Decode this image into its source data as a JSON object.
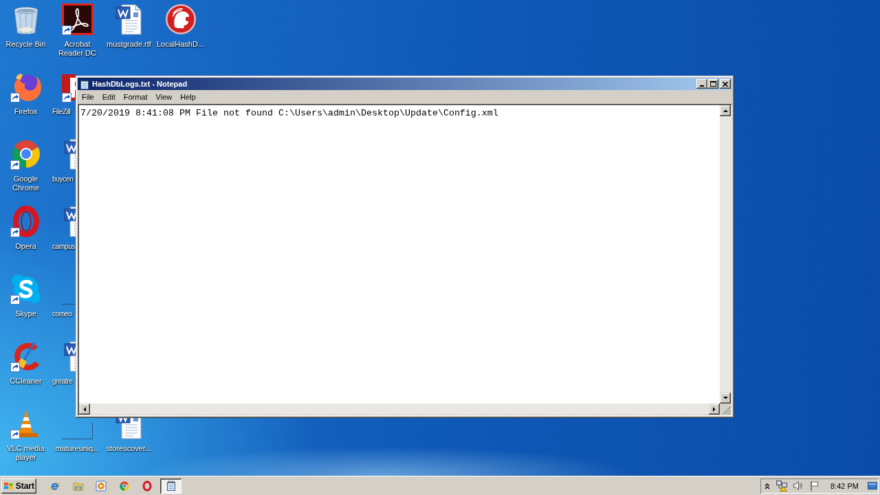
{
  "desktop": {
    "columns": [
      {
        "icons": [
          {
            "label": "Recycle Bin",
            "kind": "recyclebin",
            "shortcut": false,
            "partly_hidden": false,
            "top_hidden": false
          },
          {
            "label": "Firefox",
            "kind": "firefox",
            "shortcut": true,
            "partly_hidden": false,
            "top_hidden": false
          },
          {
            "label": "Google Chrome",
            "kind": "chrome",
            "shortcut": true,
            "partly_hidden": false,
            "top_hidden": false
          },
          {
            "label": "Opera",
            "kind": "opera",
            "shortcut": true,
            "partly_hidden": false,
            "top_hidden": false
          },
          {
            "label": "Skype",
            "kind": "skype",
            "shortcut": true,
            "partly_hidden": false,
            "top_hidden": false
          },
          {
            "label": "CCleaner",
            "kind": "ccleaner",
            "shortcut": true,
            "partly_hidden": false,
            "top_hidden": false
          },
          {
            "label": "VLC media player",
            "kind": "vlc",
            "shortcut": true,
            "partly_hidden": false,
            "top_hidden": false
          }
        ]
      },
      {
        "icons": [
          {
            "label": "Acrobat Reader DC",
            "kind": "acrobat",
            "shortcut": true,
            "partly_hidden": false,
            "top_hidden": false
          },
          {
            "label": "FileZill",
            "kind": "filezilla",
            "shortcut": true,
            "partly_hidden": true,
            "top_hidden": false
          },
          {
            "label": "buycen",
            "kind": "document",
            "shortcut": false,
            "partly_hidden": true,
            "top_hidden": false
          },
          {
            "label": "campus",
            "kind": "document",
            "shortcut": false,
            "partly_hidden": true,
            "top_hidden": false
          },
          {
            "label": "comeo",
            "kind": "blank",
            "shortcut": false,
            "partly_hidden": true,
            "top_hidden": false
          },
          {
            "label": "greatre",
            "kind": "document",
            "shortcut": false,
            "partly_hidden": true,
            "top_hidden": false
          },
          {
            "label": "matureuniq...",
            "kind": "blank",
            "shortcut": false,
            "partly_hidden": false,
            "top_hidden": false
          }
        ]
      },
      {
        "icons": [
          {
            "label": "mustgrade.rtf",
            "kind": "document",
            "shortcut": false,
            "partly_hidden": false,
            "top_hidden": false
          },
          {
            "label": "storescover...",
            "kind": "document",
            "shortcut": false,
            "partly_hidden": false,
            "top_hidden": true
          }
        ]
      },
      {
        "icons": [
          {
            "label": "LocalHashD...",
            "kind": "helmet",
            "shortcut": false,
            "partly_hidden": false,
            "top_hidden": false
          }
        ]
      }
    ]
  },
  "window": {
    "title": "HashDbLogs.txt - Notepad",
    "active": true,
    "menu": [
      "File",
      "Edit",
      "Format",
      "View",
      "Help"
    ],
    "text": "7/20/2019 8:41:08 PM File not found C:\\Users\\admin\\Desktop\\Update\\Config.xml"
  },
  "taskbar": {
    "start": "Start",
    "quick_launch": [
      {
        "kind": "ie"
      },
      {
        "kind": "explorer"
      },
      {
        "kind": "media"
      },
      {
        "kind": "chrome"
      },
      {
        "kind": "opera"
      }
    ],
    "tasks": [
      {
        "kind": "notepad",
        "selected": true
      }
    ],
    "clock": "8:42 PM"
  }
}
